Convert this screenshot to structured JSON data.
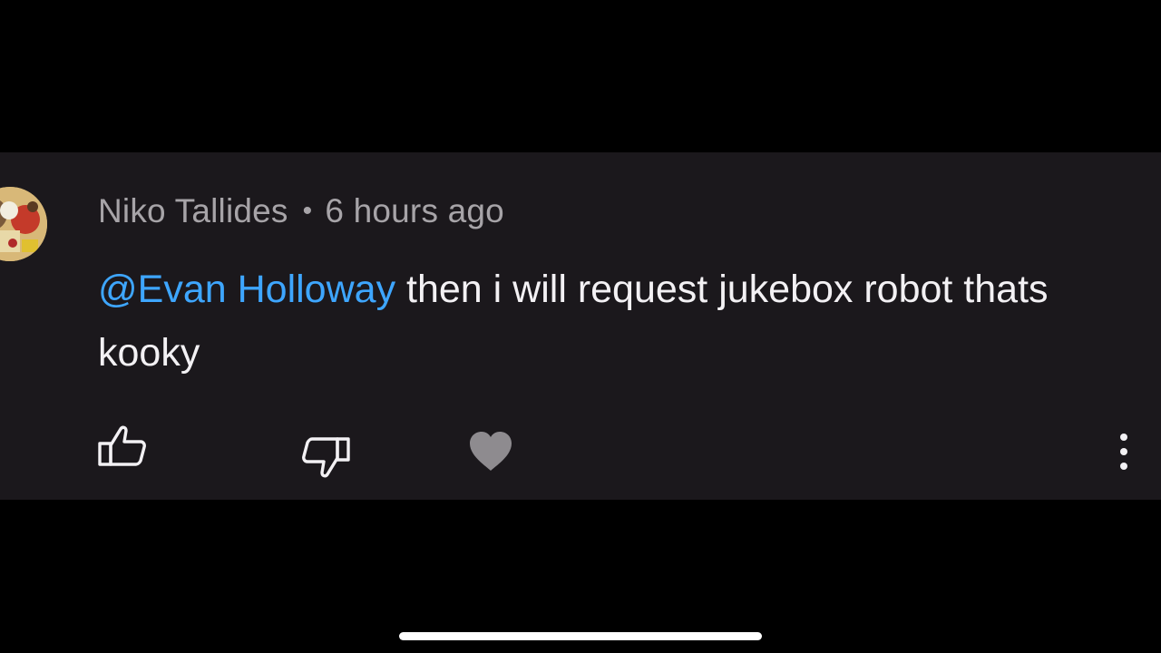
{
  "comment": {
    "author": "Niko Tallides",
    "separator": "•",
    "timestamp": "6 hours ago",
    "mention": "@Evan Holloway",
    "text": " then i will request jukebox robot thats kooky"
  },
  "actions": {
    "like": "like-icon",
    "dislike": "dislike-icon",
    "heart": "heart-icon",
    "more": "more-vertical-icon"
  },
  "colors": {
    "background": "#000000",
    "card": "#1b181c",
    "meta_text": "#a7a4a8",
    "body_text": "#f3f1f4",
    "mention": "#3ea6ff",
    "heart": "#8e8b8f"
  }
}
